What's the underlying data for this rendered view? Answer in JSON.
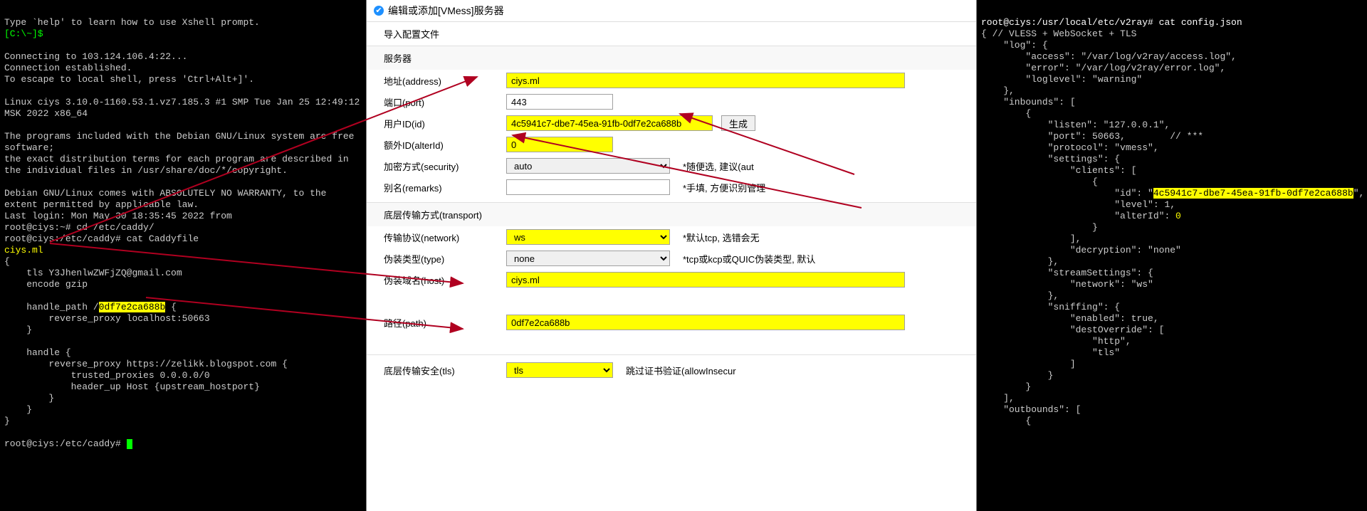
{
  "left_terminal": {
    "line_help": "Type `help' to learn how to use Xshell prompt.",
    "prompt1": "[C:\\~]$",
    "connecting": "Connecting to 103.124.106.4:22...",
    "established": "Connection established.",
    "escape": "To escape to local shell, press 'Ctrl+Alt+]'.",
    "linux": "Linux ciys 3.10.0-1160.53.1.vz7.185.3 #1 SMP Tue Jan 25 12:49:12 MSK 2022 x86_64",
    "debian1": "The programs included with the Debian GNU/Linux system are free software;",
    "debian2": "the exact distribution terms for each program are described in the individual files in /usr/share/doc/*/copyright.",
    "debian3": "Debian GNU/Linux comes with ABSOLUTELY NO WARRANTY, to the extent permitted by applicable law.",
    "lastlogin": "Last login: Mon May 30 18:35:45 2022 from ",
    "p_cd": "root@ciys:~# cd /etc/caddy/",
    "p_cat": "root@ciys:/etc/caddy# cat Caddyfile",
    "caddy_host": "ciys.ml",
    "caddy_open": "{",
    "caddy_tls": "    tls Y3JhenlwZWFjZQ@gmail.com",
    "caddy_gzip": "    encode gzip",
    "caddy_hp_pre": "    handle_path /",
    "caddy_hp_hl": "0df7e2ca688b",
    "caddy_hp_post": " {",
    "caddy_rp1": "        reverse_proxy localhost:50663",
    "caddy_close1": "    }",
    "caddy_handle": "    handle {",
    "caddy_rp2": "        reverse_proxy https://zelikk.blogspot.com {",
    "caddy_trusted": "            trusted_proxies 0.0.0.0/0",
    "caddy_header": "            header_up Host {upstream_hostport}",
    "caddy_close2a": "        }",
    "caddy_close2b": "    }",
    "caddy_close3": "}",
    "p_end": "root@ciys:/etc/caddy# "
  },
  "gui": {
    "title": "编辑或添加[VMess]服务器",
    "import": "导入配置文件",
    "section_server": "服务器",
    "lbl_address": "地址(address)",
    "val_address": "ciys.ml",
    "lbl_port": "端口(port)",
    "val_port": "443",
    "lbl_id": "用户ID(id)",
    "val_id": "4c5941c7-dbe7-45ea-91fb-0df7e2ca688b",
    "btn_gen": "生成",
    "lbl_alter": "额外ID(alterId)",
    "val_alter": "0",
    "lbl_security": "加密方式(security)",
    "val_security": "auto",
    "hint_security": "*随便选, 建议(aut",
    "lbl_remarks": "别名(remarks)",
    "val_remarks": "",
    "hint_remarks": "*手填, 方便识别管理",
    "section_transport": "底层传输方式(transport)",
    "lbl_network": "传输协议(network)",
    "val_network": "ws",
    "hint_network": "*默认tcp, 选错会无",
    "lbl_type": "伪装类型(type)",
    "val_type": "none",
    "hint_type": "*tcp或kcp或QUIC伪装类型, 默认",
    "lbl_host": "伪装域名(host)",
    "val_host": "ciys.ml",
    "lbl_path": "路径(path)",
    "val_path": "0df7e2ca688b",
    "lbl_tls": "底层传输安全(tls)",
    "val_tls": "tls",
    "hint_tls": "跳过证书验证(allowInsecur"
  },
  "right_terminal": {
    "prompt": "root@ciys:/usr/local/etc/v2ray# cat config.json",
    "l1": "{ // VLESS + WebSocket + TLS",
    "l2": "    \"log\": {",
    "l3": "        \"access\": \"/var/log/v2ray/access.log\",",
    "l4": "        \"error\": \"/var/log/v2ray/error.log\",",
    "l5": "        \"loglevel\": \"warning\"",
    "l6": "    },",
    "l7": "    \"inbounds\": [",
    "l8": "        {",
    "l9": "            \"listen\": \"127.0.0.1\",",
    "l10": "            \"port\": 50663,        // ***",
    "l11": "            \"protocol\": \"vmess\",",
    "l12": "            \"settings\": {",
    "l13": "                \"clients\": [",
    "l14": "                    {",
    "l15a": "                        \"id\": \"",
    "l15b": "4c5941c7-dbe7-45ea-91fb-0df7e2ca688b",
    "l15c": "\",   // ***",
    "l16": "                        \"level\": 1,",
    "l17a": "                        \"alterId\": ",
    "l17b": "0",
    "l18": "                    }",
    "l19": "                ],",
    "l20": "                \"decryption\": \"none\"",
    "l21": "            },",
    "l22": "            \"streamSettings\": {",
    "l23": "                \"network\": \"ws\"",
    "l24": "            },",
    "l25": "            \"sniffing\": {",
    "l26": "                \"enabled\": true,",
    "l27": "                \"destOverride\": [",
    "l28": "                    \"http\",",
    "l29": "                    \"tls\"",
    "l30": "                ]",
    "l31": "            }",
    "l32": "        }",
    "l33": "    ],",
    "l34": "    \"outbounds\": [",
    "l35": "        {"
  }
}
